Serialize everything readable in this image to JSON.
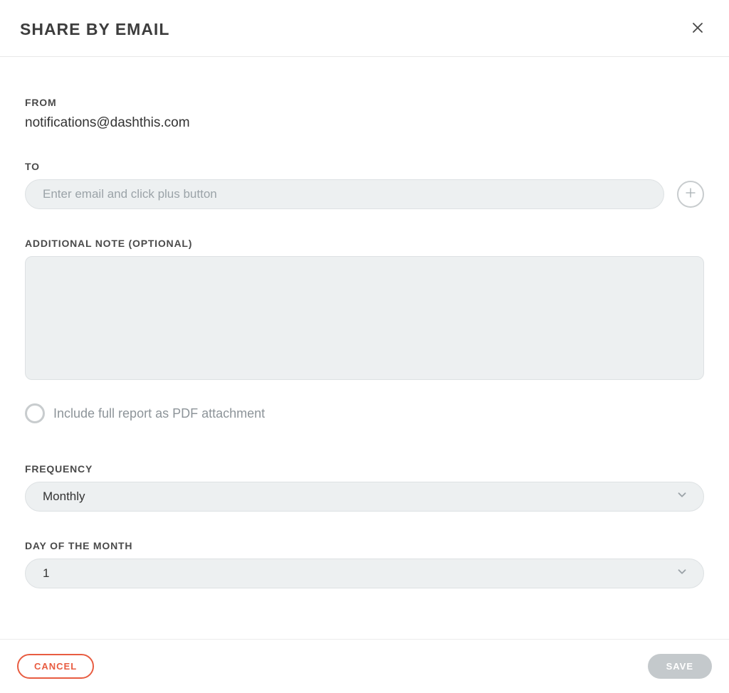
{
  "header": {
    "title": "SHARE BY EMAIL"
  },
  "from": {
    "label": "FROM",
    "email": "notifications@dashthis.com"
  },
  "to": {
    "label": "TO",
    "placeholder": "Enter email and click plus button"
  },
  "note": {
    "label": "ADDITIONAL NOTE (OPTIONAL)",
    "value": ""
  },
  "pdf": {
    "label": "Include full report as PDF attachment"
  },
  "frequency": {
    "label": "FREQUENCY",
    "value": "Monthly"
  },
  "dayOfMonth": {
    "label": "DAY OF THE MONTH",
    "value": "1"
  },
  "footer": {
    "cancel": "CANCEL",
    "save": "SAVE"
  }
}
